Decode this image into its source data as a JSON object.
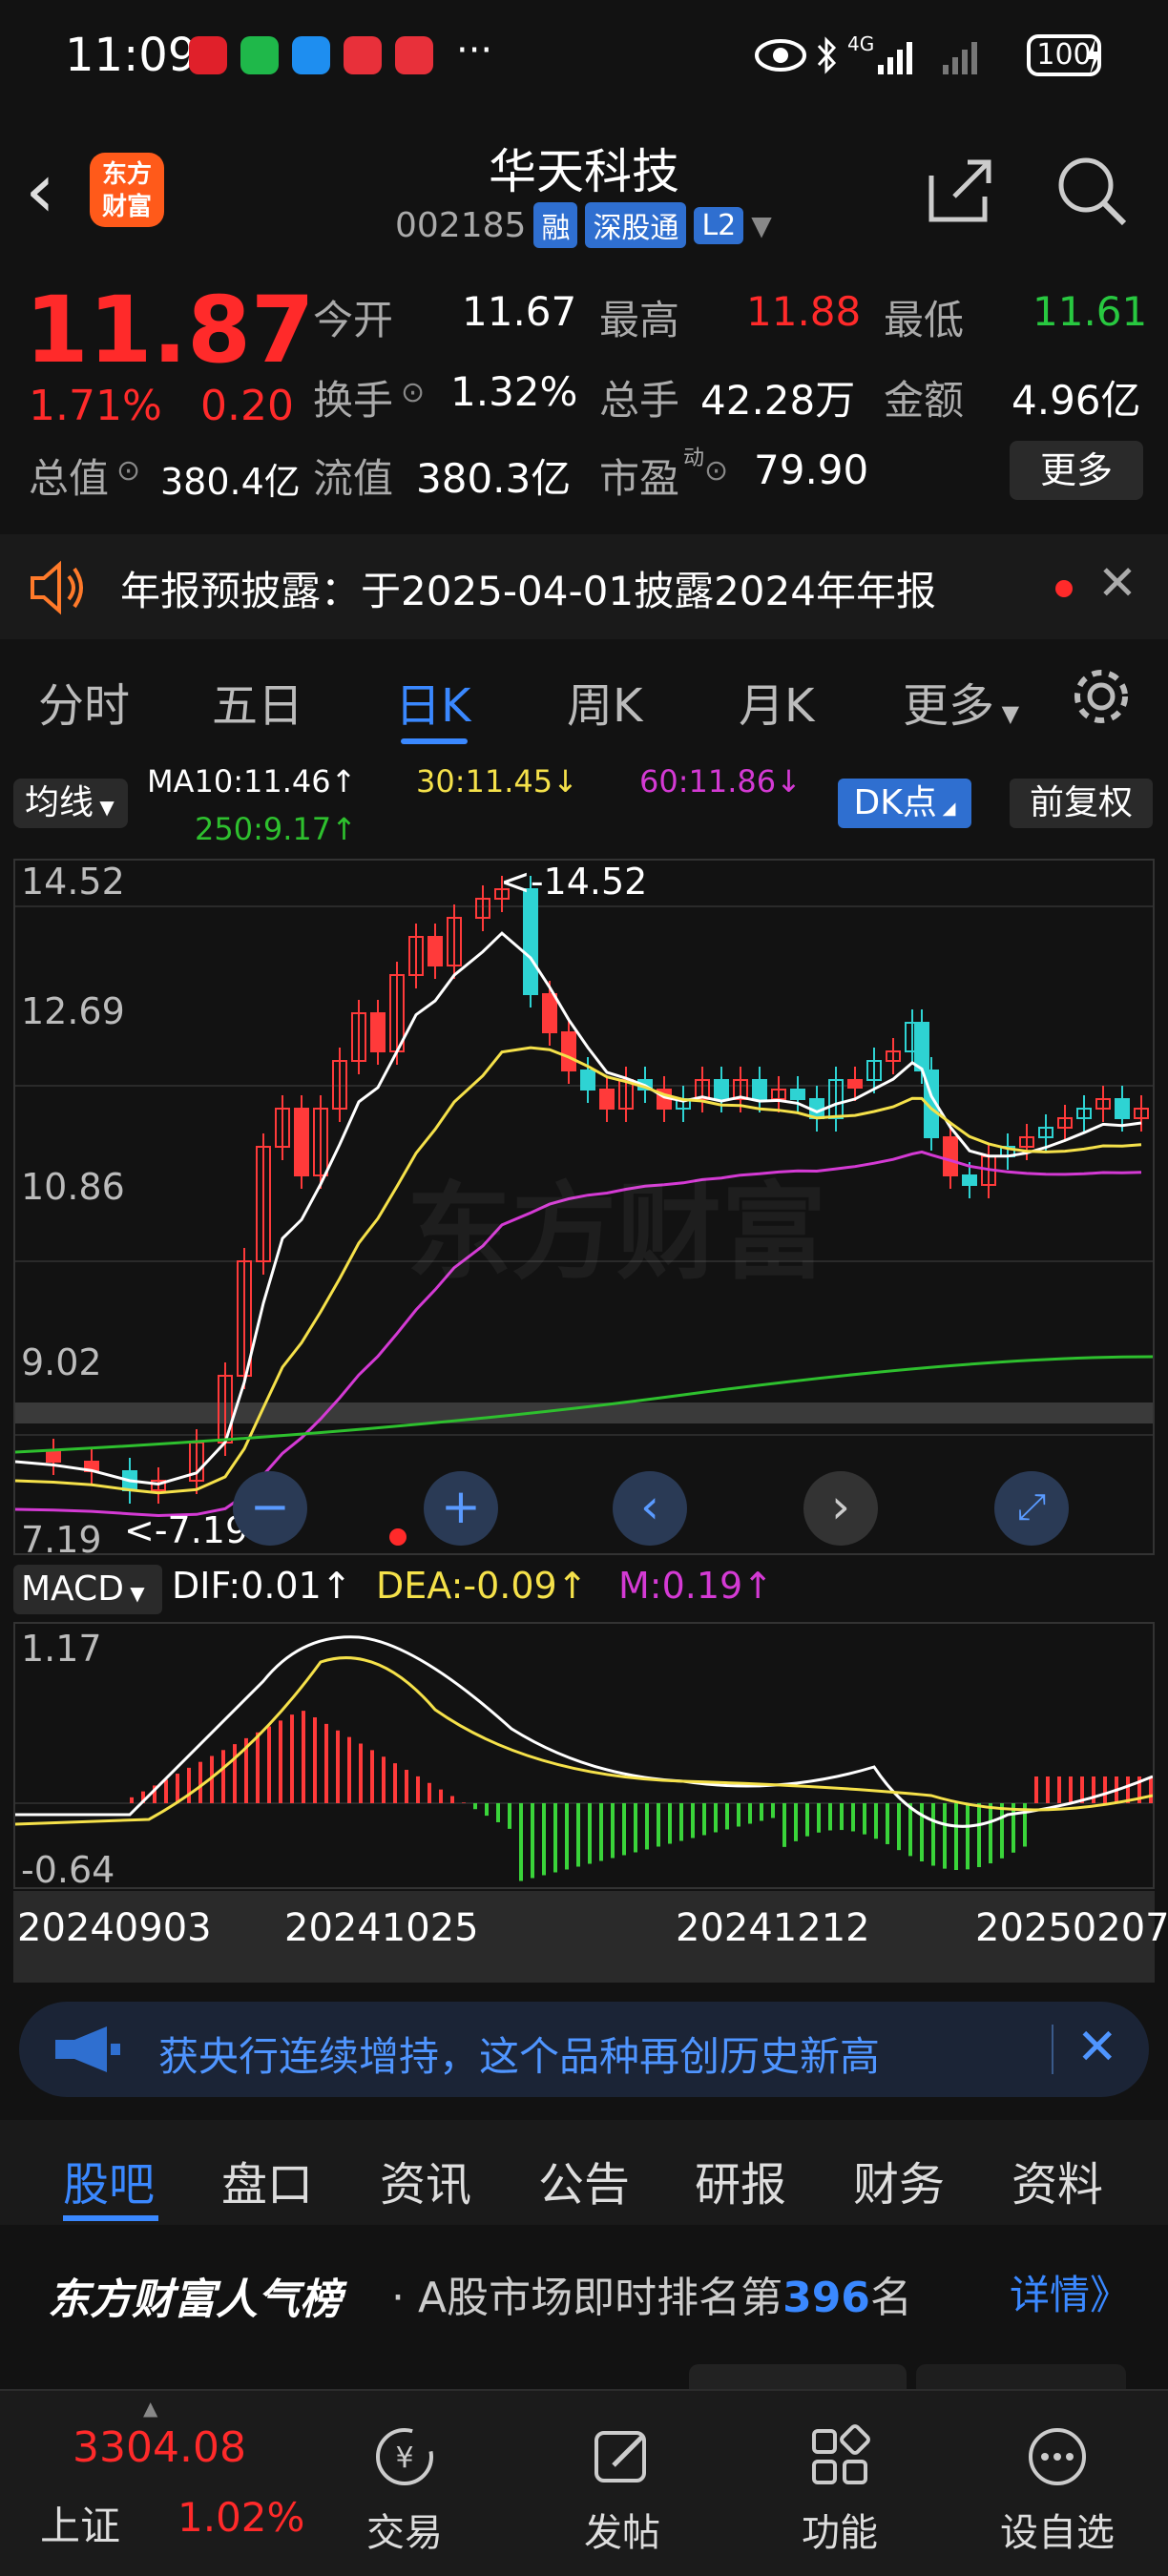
{
  "status": {
    "time": "11:09",
    "network": "4G",
    "battery": "100"
  },
  "header": {
    "logo_top": "东方",
    "logo_bottom": "财富",
    "title": "华天科技",
    "code": "002185",
    "tags": [
      "融",
      "深股通",
      "L2"
    ]
  },
  "quote": {
    "price": "11.87",
    "pct": "1.71%",
    "change": "0.20",
    "open_label": "今开",
    "open": "11.67",
    "high_label": "最高",
    "high": "11.88",
    "low_label": "最低",
    "low": "11.61",
    "turnover_label": "换手",
    "turnover": "1.32%",
    "volume_label": "总手",
    "volume": "42.28万",
    "amount_label": "金额",
    "amount": "4.96亿",
    "mktcap_label": "总值",
    "mktcap": "380.4亿",
    "float_label": "流值",
    "float": "380.3亿",
    "pe_label": "市盈",
    "pe_sup": "动",
    "pe": "79.90",
    "more": "更多"
  },
  "notice": {
    "text": "年报预披露：于2025-04-01披露2024年年报"
  },
  "ktabs": [
    "分时",
    "五日",
    "日K",
    "周K",
    "月K",
    "更多"
  ],
  "ma": {
    "button": "均线",
    "ma10": "MA10:11.46↑",
    "ma30": "30:11.45↓",
    "ma60": "60:11.86↓",
    "ma250": "250:9.17↑",
    "dk": "DK点",
    "fq": "前复权",
    "colors": {
      "ma10": "#ffffff",
      "ma30": "#f5e14a",
      "ma60": "#d43ad4",
      "ma250": "#2ec02e"
    }
  },
  "chart_data": {
    "type": "candlestick",
    "y_ticks": [
      "14.52",
      "12.69",
      "10.86",
      "9.02",
      "7.19"
    ],
    "high_marker": "<-14.52",
    "low_marker": "<-7.19",
    "ylim": [
      7.19,
      14.52
    ],
    "watermark": "东方财富",
    "macd": {
      "label": "MACD",
      "dif": "DIF:0.01↑",
      "dea": "DEA:-0.09↑",
      "m": "M:0.19↑",
      "ylim": [
        -0.64,
        1.17
      ],
      "ticks": [
        "1.17",
        "-0.64"
      ]
    },
    "dates": [
      "20240903",
      "20241025",
      "20241212",
      "20250207"
    ]
  },
  "banner": {
    "text": "获央行连续增持，这个品种再创历史新高"
  },
  "infotabs": [
    "股吧",
    "盘口",
    "资讯",
    "公告",
    "研报",
    "财务",
    "资料"
  ],
  "rank": {
    "title": "东方财富人气榜",
    "text_prefix": "· A股市场即时排名第",
    "num": "396",
    "text_suffix": "名",
    "link": "详情》"
  },
  "bottomnav": {
    "index_value": "3304.08",
    "index_name": "上证",
    "index_pct": "1.02%",
    "items": [
      "交易",
      "发帖",
      "功能",
      "设自选"
    ]
  }
}
